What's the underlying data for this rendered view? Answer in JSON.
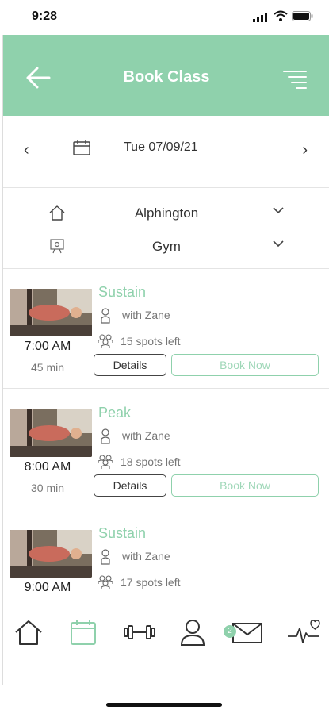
{
  "status_bar": {
    "time": "9:28"
  },
  "header": {
    "title": "Book Class"
  },
  "date_nav": {
    "date": "Tue 07/09/21"
  },
  "filters": {
    "location": "Alphington",
    "area": "Gym"
  },
  "classes": [
    {
      "name": "Sustain",
      "instructor": "with Zane",
      "spots": "15 spots left",
      "time": "7:00 AM",
      "duration": "45 min",
      "details_label": "Details",
      "book_label": "Book Now"
    },
    {
      "name": "Peak",
      "instructor": "with Zane",
      "spots": "18 spots left",
      "time": "8:00 AM",
      "duration": "30 min",
      "details_label": "Details",
      "book_label": "Book Now"
    },
    {
      "name": "Sustain",
      "instructor": "with Zane",
      "spots": "17 spots left",
      "time": "9:00 AM",
      "duration": "",
      "details_label": "",
      "book_label": ""
    }
  ],
  "tabbar": {
    "messages_badge": "2"
  },
  "colors": {
    "accent": "#8fd1ac",
    "text": "#333333",
    "muted": "#777777"
  },
  "icons": [
    "back-arrow-icon",
    "menu-icon",
    "calendar-icon",
    "home-outline-icon",
    "location-board-icon",
    "chevron-down-icon",
    "person-icon",
    "group-icon",
    "home-icon",
    "calendar-tab-icon",
    "dumbbell-icon",
    "profile-icon",
    "mail-icon",
    "heartbeat-icon"
  ]
}
